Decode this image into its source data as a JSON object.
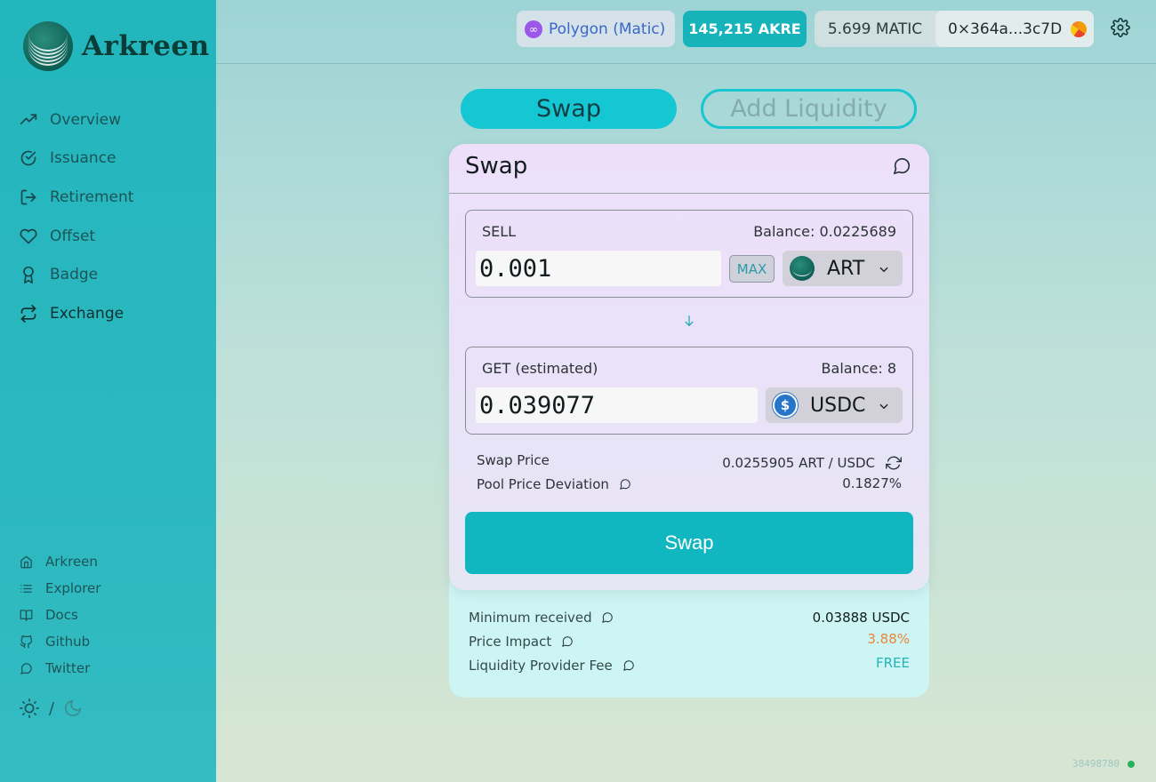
{
  "brand": {
    "name": "Arkreen"
  },
  "nav": [
    {
      "label": "Overview",
      "icon": "trending-up-icon"
    },
    {
      "label": "Issuance",
      "icon": "check-circle-icon"
    },
    {
      "label": "Retirement",
      "icon": "log-out-icon"
    },
    {
      "label": "Offset",
      "icon": "heart-icon"
    },
    {
      "label": "Badge",
      "icon": "award-icon"
    },
    {
      "label": "Exchange",
      "icon": "repeat-icon",
      "active": true
    }
  ],
  "links": [
    {
      "label": "Arkreen",
      "icon": "home-icon"
    },
    {
      "label": "Explorer",
      "icon": "list-icon"
    },
    {
      "label": "Docs",
      "icon": "book-icon"
    },
    {
      "label": "Github",
      "icon": "github-icon"
    },
    {
      "label": "Twitter",
      "icon": "message-icon"
    }
  ],
  "theme": {
    "separator": "/"
  },
  "topbar": {
    "network": "Polygon (Matic)",
    "akre_balance": "145,215 AKRE",
    "matic_balance": "5.699 MATIC",
    "address": "0×364a...3c7D"
  },
  "tabs": {
    "swap": "Swap",
    "add_liquidity": "Add Liquidity"
  },
  "card": {
    "title": "Swap",
    "sell": {
      "label": "SELL",
      "balance": "Balance: 0.0225689",
      "amount": "0.001",
      "max": "MAX",
      "token": "ART"
    },
    "get": {
      "label": "GET (estimated)",
      "balance": "Balance: 8",
      "amount": "0.039077",
      "token": "USDC"
    },
    "swap_price_label": "Swap Price",
    "swap_price_value": "0.0255905 ART / USDC",
    "deviation_label": "Pool Price Deviation",
    "deviation_value": "0.1827%",
    "swap_button": "Swap"
  },
  "details": {
    "min_received_label": "Minimum received",
    "min_received_value": "0.03888 USDC",
    "price_impact_label": "Price Impact",
    "price_impact_value": "3.88%",
    "lp_fee_label": "Liquidity Provider Fee",
    "lp_fee_value": "FREE"
  },
  "block_number": "38498780",
  "colors": {
    "accent": "#10b6c0",
    "impact": "#e9853a",
    "fee": "#22b4b9",
    "status_dot": "#27b25e"
  }
}
